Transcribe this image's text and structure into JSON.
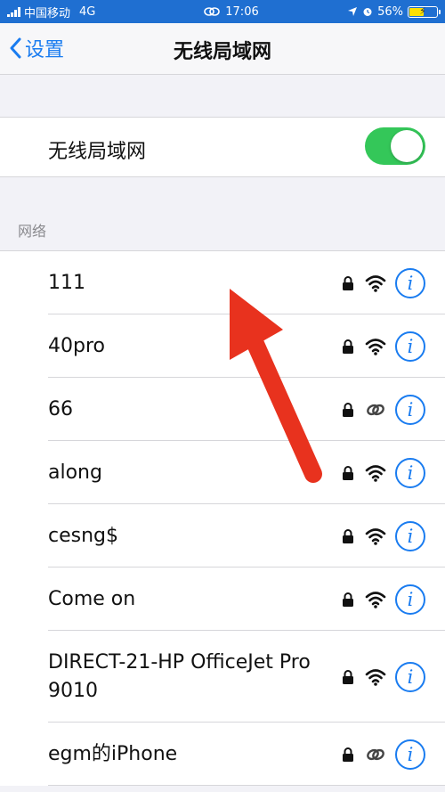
{
  "statusbar": {
    "carrier": "中国移动",
    "network": "4G",
    "time": "17:06",
    "battery": "56%",
    "battery_level": 0.56
  },
  "navbar": {
    "back_label": "设置",
    "title": "无线局域网"
  },
  "wifi": {
    "label": "无线局域网",
    "enabled": true
  },
  "networks_section": {
    "header": "网络",
    "items": [
      {
        "name": "111",
        "secured": true,
        "signal": "wifi-icon"
      },
      {
        "name": "40pro",
        "secured": true,
        "signal": "wifi-icon"
      },
      {
        "name": "66",
        "secured": true,
        "signal": "hotspot-link-icon"
      },
      {
        "name": "along",
        "secured": true,
        "signal": "wifi-icon"
      },
      {
        "name": "cesng$",
        "secured": true,
        "signal": "wifi-icon"
      },
      {
        "name": "Come on",
        "secured": true,
        "signal": "wifi-icon"
      },
      {
        "name": "DIRECT-21-HP OfficeJet Pro 9010",
        "secured": true,
        "signal": "wifi-icon"
      },
      {
        "name": "egm的iPhone",
        "secured": true,
        "signal": "hotspot-link-icon"
      }
    ]
  },
  "colors": {
    "accent": "#1a7cf0",
    "toggle_on": "#34c759",
    "statusbar_bg": "#1f6fd1",
    "annotation_arrow": "#e8321e"
  }
}
